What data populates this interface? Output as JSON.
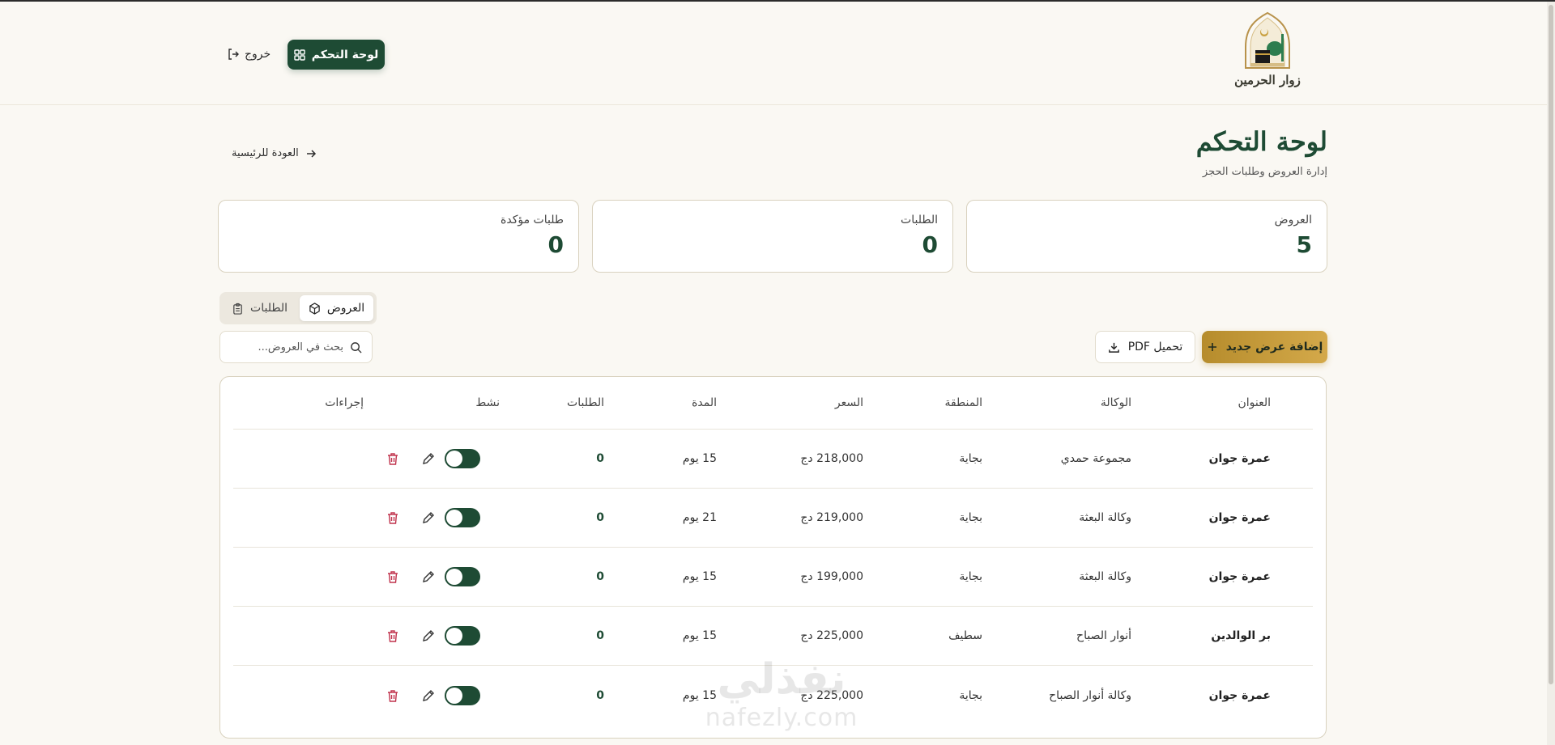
{
  "header": {
    "logo_text": "زوار الحرمين",
    "dashboard_button": "لوحة التحكم",
    "logout": "خروج"
  },
  "page": {
    "title": "لوحة التحكم",
    "subtitle": "إدارة العروض وطلبات الحجز",
    "back_link": "العودة للرئيسية"
  },
  "stats": [
    {
      "label": "العروض",
      "value": "5"
    },
    {
      "label": "الطلبات",
      "value": "0"
    },
    {
      "label": "طلبات مؤكدة",
      "value": "0"
    }
  ],
  "tabs": [
    {
      "label": "العروض",
      "active": true
    },
    {
      "label": "الطلبات",
      "active": false
    }
  ],
  "search": {
    "placeholder": "بحث في العروض..."
  },
  "actions": {
    "add_offer": "إضافة عرض جديد",
    "download_pdf": "تحميل PDF"
  },
  "table": {
    "headers": {
      "title": "العنوان",
      "agency": "الوكالة",
      "region": "المنطقة",
      "price": "السعر",
      "duration": "المدة",
      "requests": "الطلبات",
      "active": "نشط",
      "actions": "إجراءات"
    },
    "rows": [
      {
        "title": "عمرة جوان",
        "agency": "مجموعة حمدي",
        "region": "بجاية",
        "price": "218,000 دج",
        "duration": "15 يوم",
        "requests": "0",
        "active": true
      },
      {
        "title": "عمرة جوان",
        "agency": "وكالة البعثة",
        "region": "بجاية",
        "price": "219,000 دج",
        "duration": "21 يوم",
        "requests": "0",
        "active": true
      },
      {
        "title": "عمرة جوان",
        "agency": "وكالة البعثة",
        "region": "بجاية",
        "price": "199,000 دج",
        "duration": "15 يوم",
        "requests": "0",
        "active": true
      },
      {
        "title": "بر الوالدين",
        "agency": "أنوار الصباح",
        "region": "سطيف",
        "price": "225,000 دج",
        "duration": "15 يوم",
        "requests": "0",
        "active": true
      },
      {
        "title": "عمرة جوان",
        "agency": "وكالة أنوار الصباح",
        "region": "بجاية",
        "price": "225,000 دج",
        "duration": "15 يوم",
        "requests": "0",
        "active": true
      }
    ]
  },
  "watermark": {
    "arabic": "نفذلي",
    "latin": "nafezly.com"
  },
  "colors": {
    "primary": "#1e4b34",
    "accent": "#c9a040",
    "danger": "#c0334d",
    "background": "#faf8f3"
  }
}
